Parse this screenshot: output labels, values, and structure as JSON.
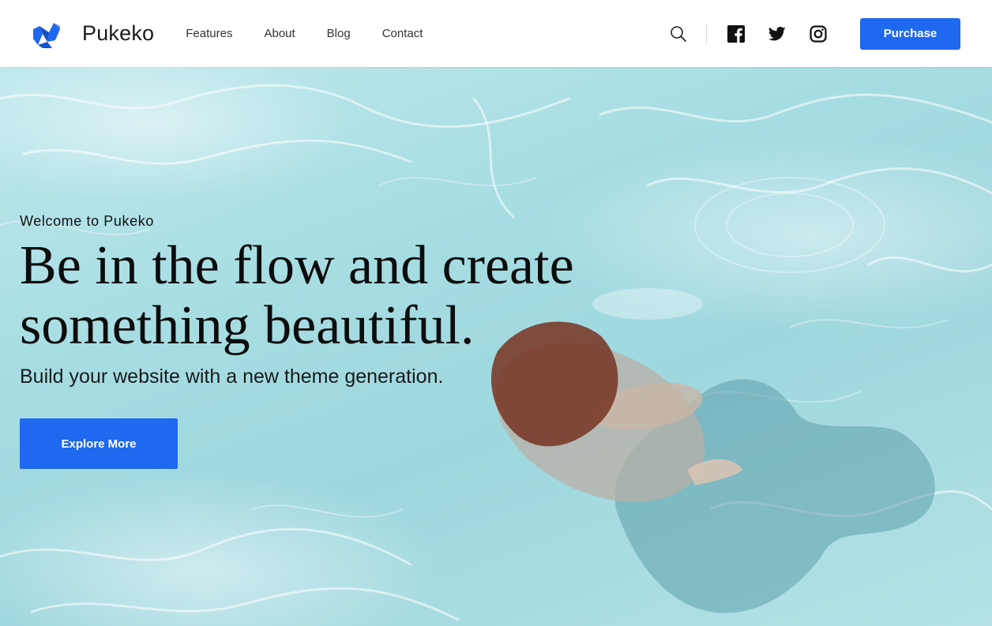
{
  "header": {
    "brand": "Pukeko",
    "nav": [
      {
        "label": "Features"
      },
      {
        "label": "About"
      },
      {
        "label": "Blog"
      },
      {
        "label": "Contact"
      }
    ],
    "icons": {
      "search": "search-icon",
      "facebook": "facebook-icon",
      "twitter": "twitter-icon",
      "instagram": "instagram-icon"
    },
    "purchase_label": "Purchase"
  },
  "hero": {
    "eyebrow": "Welcome to Pukeko",
    "headline_line1": "Be in the flow and create",
    "headline_line2": "something beautiful.",
    "subheading": "Build your website with a new theme generation.",
    "cta_label": "Explore More"
  },
  "colors": {
    "accent": "#1f68f0",
    "water": "#a6dde3",
    "text": "#111111"
  }
}
